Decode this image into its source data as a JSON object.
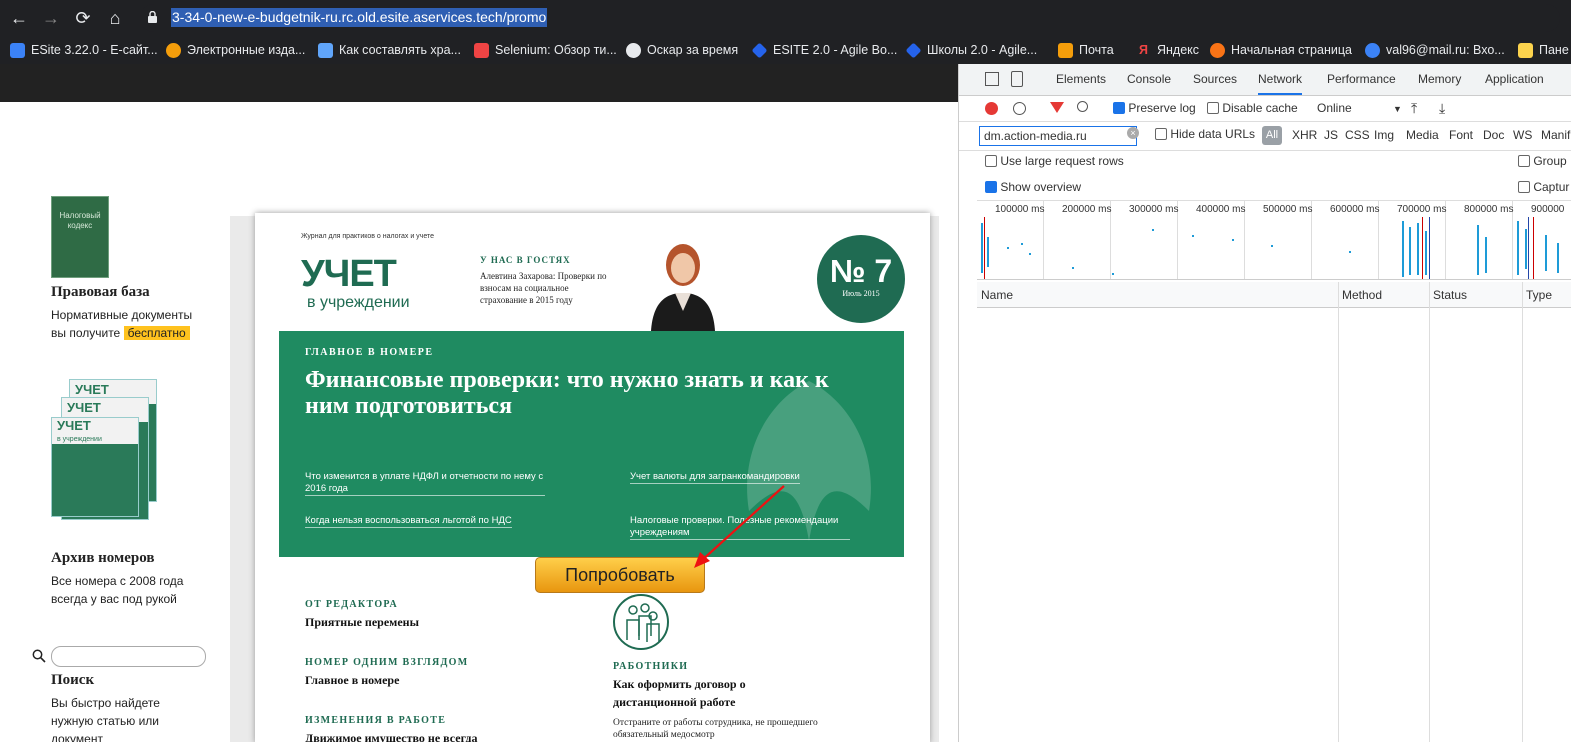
{
  "browser": {
    "url": "3-34-0-new-e-budgetnik-ru.rc.old.esite.aservices.tech/promo",
    "nav": {
      "back": "←",
      "forward": "→",
      "reload": "⟳",
      "home": "⌂"
    }
  },
  "bookmarks": [
    {
      "label": "ESite 3.22.0 - E-сайт...",
      "icon": "x-icon",
      "color": "#3b82f6"
    },
    {
      "label": "Электронные изда...",
      "icon": "gear-orange-icon",
      "color": "#f59e0b"
    },
    {
      "label": "Как составлять хра...",
      "icon": "chart-icon",
      "color": "#60a5fa"
    },
    {
      "label": "Selenium: Обзор ти...",
      "icon": "doc-red-icon",
      "color": "#ef4444"
    },
    {
      "label": "Оскар за время",
      "icon": "globe-icon",
      "color": "#e8eaed"
    },
    {
      "label": "ESITE 2.0 - Agile Bo...",
      "icon": "diamond-icon",
      "color": "#2563eb"
    },
    {
      "label": "Школы 2.0 - Agile...",
      "icon": "diamond-icon",
      "color": "#2563eb"
    },
    {
      "label": "Почта",
      "icon": "mail-icon",
      "color": "#f59e0b"
    },
    {
      "label": "Яндекс",
      "icon": "yandex-icon",
      "color": "#ef4444"
    },
    {
      "label": "Начальная страница",
      "icon": "firefox-icon",
      "color": "#f97316"
    },
    {
      "label": "val96@mail.ru: Вхо...",
      "icon": "at-icon",
      "color": "#3b82f6"
    },
    {
      "label": "Пане",
      "icon": "folder-icon",
      "color": "#fcd34d"
    }
  ],
  "sidebar": {
    "book_label": "Налоговый кодекс",
    "legal_title": "Правовая база",
    "legal_text": "Нормативные документы",
    "legal_text2": "вы получите",
    "legal_badge": "бесплатно",
    "archive_word": "УЧЕТ",
    "archive_sub": "в учреждении",
    "archive_title": "Архив номеров",
    "archive_text": "Все номера с 2008 года",
    "archive_text2": "всегда у вас под рукой",
    "search_title": "Поиск",
    "search_text": "Вы быстро найдете",
    "search_text2": "нужную статью или",
    "search_text3": "документ"
  },
  "magazine": {
    "kicker": "Журнал для практиков о налогах и учете",
    "logo": "УЧЕТ",
    "logo_sub": "в учреждении",
    "guest_heading": "У НАС В ГОСТЯХ",
    "guest_text": "Алевтина Захарова: Проверки по взносам на социальное страхование в 2015 году",
    "issue_number": "№ 7",
    "issue_date": "Июль 2015",
    "main_heading": "ГЛАВНОЕ В НОМЕРЕ",
    "main_title": "Финансовые проверки: что нужно знать и как к ним подготовиться",
    "links": [
      "Что изменится в уплате НДФЛ и отчетности по нему с 2016 года",
      "Учет валюты для загранкомандировки",
      "Когда нельзя воспользоваться льготой по НДС",
      "Налоговые проверки. Полезные рекомендации учреждениям"
    ],
    "try_button": "Попробовать",
    "editor_heading": "ОТ РЕДАКТОРА",
    "editor_title": "Приятные перемены",
    "glance_heading": "НОМЕР ОДНИМ ВЗГЛЯДОМ",
    "glance_title": "Главное в номере",
    "changes_heading": "ИЗМЕНЕНИЯ В РАБОТЕ",
    "changes_title": "Движимое имущество не всегда",
    "workers_heading": "РАБОТНИКИ",
    "workers_title": "Как оформить договор о дистанционной работе",
    "workers_sub": "Отстраните от работы сотрудника, не прошедшего обязательный медосмотр"
  },
  "devtools": {
    "tabs": [
      "Elements",
      "Console",
      "Sources",
      "Network",
      "Performance",
      "Memory",
      "Application"
    ],
    "active_tab": "Network",
    "preserve_log": "Preserve log",
    "disable_cache": "Disable cache",
    "throttle": "Online",
    "filter_value": "dm.action-media.ru",
    "hide_data_urls": "Hide data URLs",
    "all": "All",
    "types": [
      "XHR",
      "JS",
      "CSS",
      "Img",
      "Media",
      "Font",
      "Doc",
      "WS",
      "Manif"
    ],
    "large_rows": "Use large request rows",
    "group": "Group",
    "show_overview": "Show overview",
    "capture": "Captur",
    "timeline_ticks": [
      "100000 ms",
      "200000 ms",
      "300000 ms",
      "400000 ms",
      "500000 ms",
      "600000 ms",
      "700000 ms",
      "800000 ms",
      "900000"
    ],
    "columns": [
      "Name",
      "Method",
      "Status",
      "Type"
    ]
  },
  "colors": {
    "magazine_green": "#1f8b61",
    "badge": "#ffc21e",
    "button": "#f2b12a",
    "devtools_accent": "#1a73e8"
  }
}
